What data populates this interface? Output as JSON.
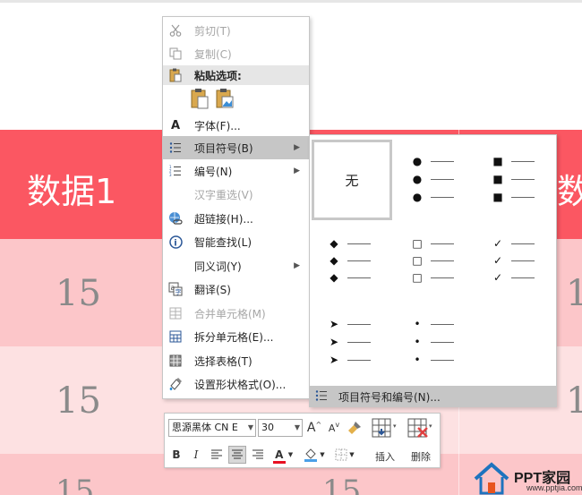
{
  "table": {
    "header_cells": [
      "数据1",
      "数"
    ],
    "row1_cells": [
      "15",
      "1"
    ],
    "row2_cells": [
      "15",
      "1"
    ],
    "row3_cells": [
      "15",
      "15"
    ]
  },
  "context_menu": {
    "items": [
      {
        "label": "剪切(T)",
        "icon": "scissors-icon",
        "enabled": false
      },
      {
        "label": "复制(C)",
        "icon": "copy-icon",
        "enabled": false
      },
      {
        "label": "粘贴选项:",
        "icon": "paste-icon",
        "enabled": true
      },
      {
        "label": "字体(F)...",
        "icon": "font-icon",
        "enabled": true
      },
      {
        "label": "项目符号(B)",
        "icon": "bullets-icon",
        "enabled": true,
        "submenu": true,
        "highlighted": true
      },
      {
        "label": "编号(N)",
        "icon": "numbering-icon",
        "enabled": true,
        "submenu": true
      },
      {
        "label": "汉字重选(V)",
        "icon": "",
        "enabled": false
      },
      {
        "label": "超链接(H)...",
        "icon": "hyperlink-icon",
        "enabled": true
      },
      {
        "label": "智能查找(L)",
        "icon": "smart-lookup-icon",
        "enabled": true
      },
      {
        "label": "同义词(Y)",
        "icon": "",
        "enabled": true,
        "submenu": true
      },
      {
        "label": "翻译(S)",
        "icon": "translate-icon",
        "enabled": true
      },
      {
        "label": "合并单元格(M)",
        "icon": "merge-cells-icon",
        "enabled": false
      },
      {
        "label": "拆分单元格(E)...",
        "icon": "split-cells-icon",
        "enabled": true
      },
      {
        "label": "选择表格(T)",
        "icon": "select-table-icon",
        "enabled": true
      },
      {
        "label": "设置形状格式(O)...",
        "icon": "format-shape-icon",
        "enabled": true
      }
    ]
  },
  "bullet_submenu": {
    "none_label": "无",
    "styles": [
      {
        "name": "filled-round",
        "symbol": "●"
      },
      {
        "name": "filled-square",
        "symbol": "■"
      },
      {
        "name": "filled-diamond",
        "symbol": "◆"
      },
      {
        "name": "hollow-square",
        "symbol": "□"
      },
      {
        "name": "check-mark",
        "symbol": "✓"
      },
      {
        "name": "arrowhead",
        "symbol": "➤"
      },
      {
        "name": "small-dot",
        "symbol": "•"
      }
    ],
    "footer_label": "项目符号和编号(N)..."
  },
  "mini_toolbar": {
    "font_name": "思源黑体 CN E",
    "font_size": "30",
    "grow_font": "A",
    "shrink_font": "A",
    "bold": "B",
    "italic": "I",
    "font_color_letter": "A",
    "insert_label": "插入",
    "delete_label": "删除",
    "colors": {
      "font_color": "#e81123",
      "highlight": "#4aa0e8"
    }
  },
  "watermark": {
    "title": "PPT家园",
    "url": "www.pptjia.com",
    "brand_color": "#1e73be",
    "accent_color": "#e8541e"
  },
  "colors": {
    "header_red": "#fb5762",
    "row_pink": "#fcc6c9",
    "row_light": "#fde1e2",
    "menu_highlight": "#c6c6c6"
  }
}
